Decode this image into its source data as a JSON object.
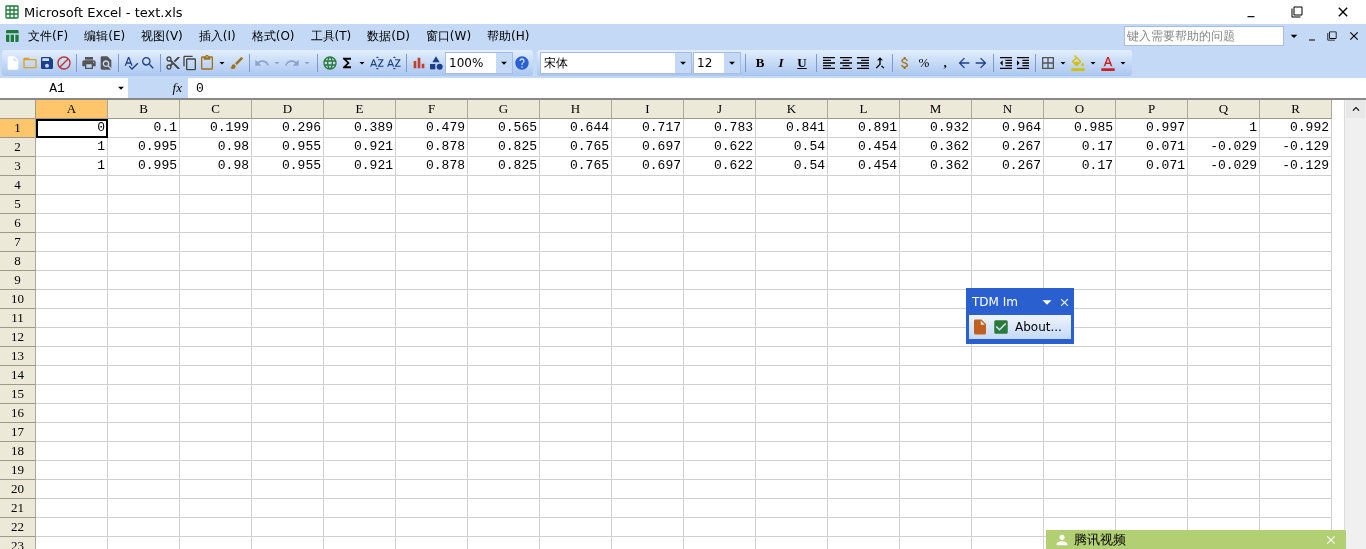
{
  "window": {
    "title": "Microsoft Excel - text.xls"
  },
  "menu": [
    "文件(F)",
    "编辑(E)",
    "视图(V)",
    "插入(I)",
    "格式(O)",
    "工具(T)",
    "数据(D)",
    "窗口(W)",
    "帮助(H)"
  ],
  "help_search": {
    "placeholder": "键入需要帮助的问题"
  },
  "standard_toolbar": {
    "zoom": "100%"
  },
  "formatting_toolbar": {
    "font": "宋体",
    "size": "12",
    "bold": "B",
    "italic": "I",
    "underline": "U",
    "percent": "%",
    "comma": ","
  },
  "formula_bar": {
    "name_box": "A1",
    "fx": "fx",
    "formula": "0"
  },
  "sheet": {
    "columns": [
      {
        "label": "A",
        "selected": true
      },
      {
        "label": "B",
        "selected": false
      },
      {
        "label": "C",
        "selected": false
      },
      {
        "label": "D",
        "selected": false
      },
      {
        "label": "E",
        "selected": false
      },
      {
        "label": "F",
        "selected": false
      },
      {
        "label": "G",
        "selected": false
      },
      {
        "label": "H",
        "selected": false
      },
      {
        "label": "I",
        "selected": false
      },
      {
        "label": "J",
        "selected": false
      },
      {
        "label": "K",
        "selected": false
      },
      {
        "label": "L",
        "selected": false
      },
      {
        "label": "M",
        "selected": false
      },
      {
        "label": "N",
        "selected": false
      },
      {
        "label": "O",
        "selected": false
      },
      {
        "label": "P",
        "selected": false
      },
      {
        "label": "Q",
        "selected": false
      },
      {
        "label": "R",
        "selected": false
      }
    ],
    "rows": [
      {
        "label": "1",
        "selected": true,
        "cells": [
          "0",
          "0.1",
          "0.199",
          "0.296",
          "0.389",
          "0.479",
          "0.565",
          "0.644",
          "0.717",
          "0.783",
          "0.841",
          "0.891",
          "0.932",
          "0.964",
          "0.985",
          "0.997",
          "1",
          "0.992"
        ]
      },
      {
        "label": "2",
        "selected": false,
        "cells": [
          "1",
          "0.995",
          "0.98",
          "0.955",
          "0.921",
          "0.878",
          "0.825",
          "0.765",
          "0.697",
          "0.622",
          "0.54",
          "0.454",
          "0.362",
          "0.267",
          "0.17",
          "0.071",
          "-0.029",
          "-0.129"
        ]
      },
      {
        "label": "3",
        "selected": false,
        "cells": [
          "1",
          "0.995",
          "0.98",
          "0.955",
          "0.921",
          "0.878",
          "0.825",
          "0.765",
          "0.697",
          "0.622",
          "0.54",
          "0.454",
          "0.362",
          "0.267",
          "0.17",
          "0.071",
          "-0.029",
          "-0.129"
        ]
      },
      {
        "label": "4",
        "selected": false
      },
      {
        "label": "5",
        "selected": false
      },
      {
        "label": "6",
        "selected": false
      },
      {
        "label": "7",
        "selected": false
      },
      {
        "label": "8",
        "selected": false
      },
      {
        "label": "9",
        "selected": false
      },
      {
        "label": "10",
        "selected": false
      },
      {
        "label": "11",
        "selected": false
      },
      {
        "label": "12",
        "selected": false
      },
      {
        "label": "13",
        "selected": false
      },
      {
        "label": "14",
        "selected": false
      },
      {
        "label": "15",
        "selected": false
      },
      {
        "label": "16",
        "selected": false
      },
      {
        "label": "17",
        "selected": false
      },
      {
        "label": "18",
        "selected": false
      },
      {
        "label": "19",
        "selected": false
      },
      {
        "label": "20",
        "selected": false
      },
      {
        "label": "21",
        "selected": false
      },
      {
        "label": "22",
        "selected": false
      },
      {
        "label": "23",
        "selected": false
      }
    ]
  },
  "tdm_toolbar": {
    "title": "TDM Im",
    "about": "About..."
  },
  "tencent_popup": {
    "title": "腾讯视频"
  }
}
